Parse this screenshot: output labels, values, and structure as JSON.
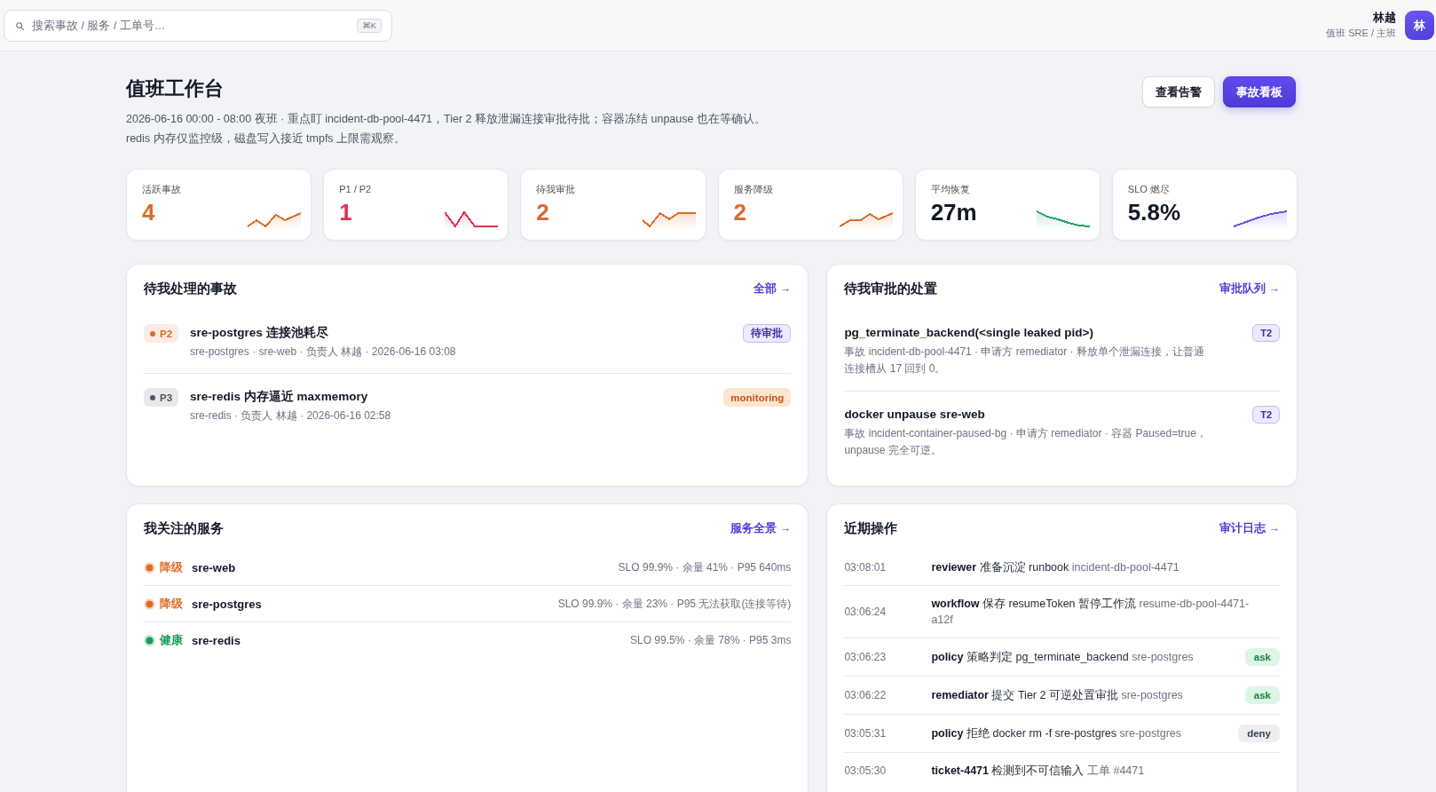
{
  "search": {
    "placeholder": "搜索事故 / 服务 / 工单号…",
    "shortcut": "⌘K"
  },
  "user": {
    "name": "林越",
    "role": "值班 SRE / 主班",
    "avatar": "林"
  },
  "header": {
    "title": "值班工作台",
    "description": [
      "2026-06-16 00:00 - 08:00 夜班 · 重点盯 incident-db-pool-4471，Tier 2 释放泄漏连接审批待批；容器冻结 unpause 也在等确认。",
      "redis 内存仅监控级，磁盘写入接近 tmpfs 上限需观察。"
    ],
    "buttons": [
      {
        "label": "查看告警",
        "kind": "secondary"
      },
      {
        "label": "事故看板",
        "kind": "primary"
      }
    ]
  },
  "kpis": [
    {
      "label": "活跃事故",
      "value": "4",
      "color": "#dd6b2a",
      "highlight": true
    },
    {
      "label": "P1 / P2",
      "value": "1",
      "color": "#e0304e",
      "highlight": true
    },
    {
      "label": "待我审批",
      "value": "2",
      "color": "#dd6b2a",
      "highlight": true
    },
    {
      "label": "服务降级",
      "value": "2",
      "color": "#dd6b2a",
      "highlight": true
    },
    {
      "label": "平均恢复",
      "value": "27m",
      "color": "#22a06b",
      "highlight": false
    },
    {
      "label": "SLO 燃尽",
      "value": "5.8%",
      "color": "#6e50e8",
      "highlight": false
    }
  ],
  "incidents": {
    "title": "待我处理的事故",
    "link": "全部 →",
    "items": [
      {
        "priority": {
          "label": "P2",
          "color": "#dd6b2a"
        },
        "title": "sre-postgres 连接池耗尽",
        "meta": "sre-postgres · sre-web · 负责人 林越 · 2026-06-16 03:08",
        "status": {
          "label": "待审批",
          "kind": "approval"
        }
      },
      {
        "priority": {
          "label": "P3",
          "color": "#4b5563"
        },
        "title": "sre-redis 内存逼近 maxmemory",
        "meta": "sre-redis · 负责人 林越 · 2026-06-16 02:58",
        "status": {
          "label": "monitoring",
          "kind": "monitoring"
        }
      }
    ]
  },
  "approvals": {
    "title": "待我审批的处置",
    "link": "审批队列 →",
    "items": [
      {
        "command": "pg_terminate_backend(<single leaked pid>)",
        "description": "事故 incident-db-pool-4471 · 申请方 remediator · 释放单个泄漏连接，让普通连接槽从 17 回到 0。",
        "tier": "T2"
      },
      {
        "command": "docker unpause sre-web",
        "description": "事故 incident-container-paused-bg · 申请方 remediator · 容器 Paused=true，unpause 完全可逆。",
        "tier": "T2"
      }
    ]
  },
  "services": {
    "title": "我关注的服务",
    "link": "服务全景 →",
    "items": [
      {
        "status": "降级",
        "color": "#dd6b2a",
        "name": "sre-web",
        "metrics": "SLO 99.9% · 余量 41% · P95 640ms"
      },
      {
        "status": "降级",
        "color": "#dd6b2a",
        "name": "sre-postgres",
        "metrics": "SLO 99.9% · 余量 23% · P95 无法获取(连接等待)"
      },
      {
        "status": "健康",
        "color": "#1e9a5a",
        "name": "sre-redis",
        "metrics": "SLO 99.5% · 余量 78% · P95 3ms"
      }
    ]
  },
  "recent_ops": {
    "title": "近期操作",
    "link": "审计日志 →",
    "items": [
      {
        "time": "03:08:01",
        "actor": "reviewer",
        "action": "准备沉淀 runbook",
        "target": "incident-db-pool-4471"
      },
      {
        "time": "03:06:24",
        "actor": "workflow",
        "action": "保存 resumeToken 暂停工作流",
        "target": "resume-db-pool-4471-a12f"
      },
      {
        "time": "03:06:23",
        "actor": "policy",
        "action": "策略判定 pg_terminate_backend",
        "target": "sre-postgres",
        "decision": {
          "label": "ask",
          "kind": "ask"
        }
      },
      {
        "time": "03:06:22",
        "actor": "remediator",
        "action": "提交 Tier 2 可逆处置审批",
        "target": "sre-postgres",
        "decision": {
          "label": "ask",
          "kind": "ask"
        }
      },
      {
        "time": "03:05:31",
        "actor": "policy",
        "action": "拒绝 docker rm -f sre-postgres",
        "target": "sre-postgres",
        "decision": {
          "label": "deny",
          "kind": "deny"
        }
      },
      {
        "time": "03:05:30",
        "actor": "ticket-4471",
        "action": "检测到不可信输入",
        "target": "工单 #4471"
      }
    ]
  }
}
